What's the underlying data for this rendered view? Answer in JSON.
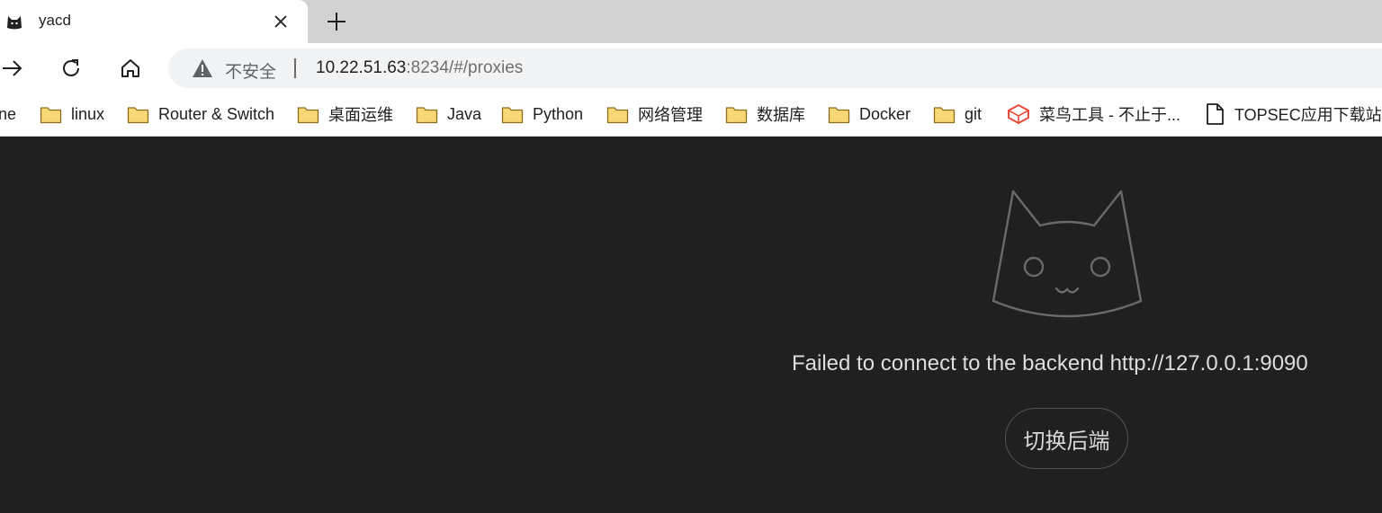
{
  "tab": {
    "title": "yacd"
  },
  "address": {
    "security_label": "不安全",
    "host": "10.22.51.63",
    "rest": ":8234/#/proxies"
  },
  "bookmarks": [
    {
      "label": "ne",
      "icon": "none"
    },
    {
      "label": "linux",
      "icon": "folder-icon"
    },
    {
      "label": "Router & Switch",
      "icon": "folder-icon"
    },
    {
      "label": "桌面运维",
      "icon": "folder-icon"
    },
    {
      "label": "Java",
      "icon": "folder-icon"
    },
    {
      "label": "Python",
      "icon": "folder-icon"
    },
    {
      "label": "网络管理",
      "icon": "folder-icon"
    },
    {
      "label": "数据库",
      "icon": "folder-icon"
    },
    {
      "label": "Docker",
      "icon": "folder-icon"
    },
    {
      "label": "git",
      "icon": "folder-icon"
    },
    {
      "label": "菜鸟工具 - 不止于...",
      "icon": "runoob-icon"
    },
    {
      "label": "TOPSEC应用下载站点",
      "icon": "page-icon"
    }
  ],
  "main": {
    "error_message": "Failed to connect to the backend http://127.0.0.1:9090",
    "switch_button": "切换后端"
  },
  "colors": {
    "background": "#202020",
    "folder": "#f8d775",
    "text": "#dddddd"
  }
}
